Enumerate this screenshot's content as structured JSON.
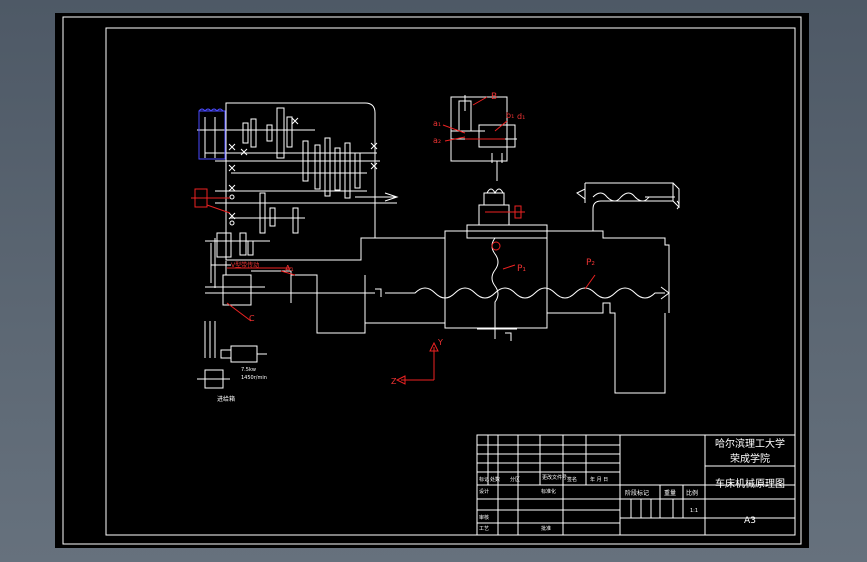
{
  "title_block": {
    "school_line1": "哈尔滨理工大学",
    "school_line2": "荣成学院",
    "drawing_name": "车床机械原理图",
    "paper_size": "A3",
    "scale": "1:1",
    "row_labels": {
      "mark": "标记",
      "count": "处数",
      "zone": "分区",
      "change_doc": "更改文件号",
      "signature": "签名",
      "date": "年 月 日",
      "design": "设计",
      "standard": "标准化",
      "check": "审核",
      "process": "工艺",
      "approve": "批准",
      "stage_mark": "阶段标记",
      "weight": "重量",
      "ratio": "比例"
    }
  },
  "annotations": {
    "B": "B",
    "a1": "a₁",
    "a2": "a₂",
    "b1": "b₁",
    "d1": "d₁",
    "A1": "A₁",
    "P1": "P₁",
    "P2": "P₂",
    "C": "C",
    "Y": "Y",
    "Z": "Z",
    "motor_power": "7.5kw",
    "motor_speed": "1450r/min",
    "belt_label": "V型带传动",
    "gearbox_label": "进给箱"
  },
  "colors": {
    "background": "#000000",
    "frame": "#ffffff",
    "highlight": "#e22222",
    "accent": "#4a4aff",
    "window_bg": "#5d6874"
  }
}
